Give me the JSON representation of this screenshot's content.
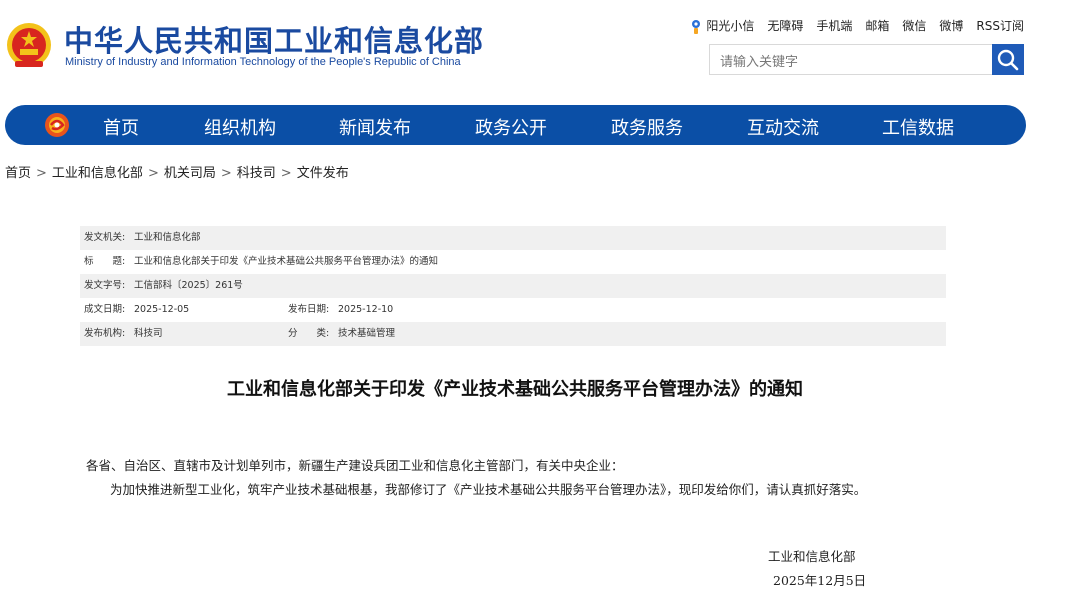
{
  "header": {
    "title": "中华人民共和国工业和信息化部",
    "subtitle": "Ministry of Industry and Information Technology of the People's Republic of China",
    "top_links": [
      "阳光小信",
      "无障碍",
      "手机端",
      "邮箱",
      "微信",
      "微博",
      "RSS订阅"
    ],
    "search_placeholder": "请输入关键字"
  },
  "nav": {
    "items": [
      "首页",
      "组织机构",
      "新闻发布",
      "政务公开",
      "政务服务",
      "互动交流",
      "工信数据"
    ]
  },
  "breadcrumb": [
    "首页",
    "工业和信息化部",
    "机关司局",
    "科技司",
    "文件发布"
  ],
  "meta": {
    "issuer_label": "发文机关:",
    "issuer": "工业和信息化部",
    "title_label": "标　　题:",
    "title": "工业和信息化部关于印发《产业技术基础公共服务平台管理办法》的通知",
    "doc_no_label": "发文字号:",
    "doc_no": "工信部科〔2025〕261号",
    "created_label": "成文日期:",
    "created": "2025-12-05",
    "published_label": "发布日期:",
    "published": "2025-12-10",
    "org_label": "发布机构:",
    "org": "科技司",
    "category_label": "分　　类:",
    "category": "技术基础管理"
  },
  "article": {
    "title": "工业和信息化部关于印发《产业技术基础公共服务平台管理办法》的通知",
    "salutation": "各省、自治区、直辖市及计划单列市，新疆生产建设兵团工业和信息化主管部门，有关中央企业：",
    "body": "为加快推进新型工业化，筑牢产业技术基础根基，我部修订了《产业技术基础公共服务平台管理办法》，现印发给你们，请认真抓好落实。",
    "sign_org": "工业和信息化部",
    "sign_date": "2025年12月5日"
  },
  "colors": {
    "brand_blue": "#0b4fa6",
    "title_blue": "#1a4aa0",
    "emblem_red": "#d8261f",
    "emblem_gold": "#f3c21a"
  }
}
